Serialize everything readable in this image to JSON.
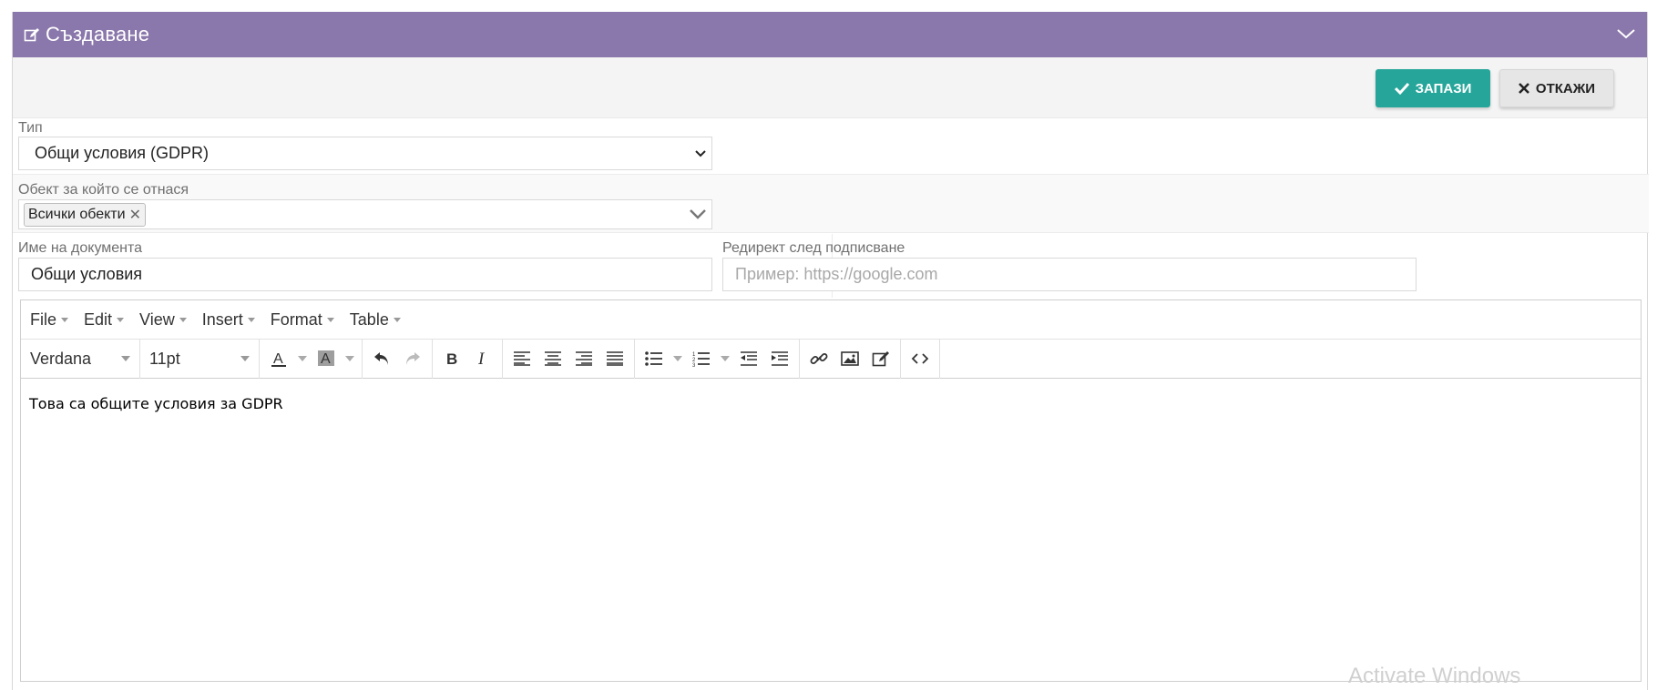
{
  "header": {
    "title": "Създаване"
  },
  "actions": {
    "save_label": "ЗАПАЗИ",
    "cancel_label": "ОТКАЖИ",
    "save_color": "#26a69a"
  },
  "form": {
    "type_label": "Тип",
    "type_value": "Общи условия (GDPR)",
    "object_label": "Обект за който се отнася",
    "object_tags": [
      "Всички обекти"
    ],
    "doc_name_label": "Име на документа",
    "doc_name_value": "Общи условия",
    "redirect_label": "Редирект след подписване",
    "redirect_placeholder": "Пример: https://google.com"
  },
  "editor": {
    "menus": [
      "File",
      "Edit",
      "View",
      "Insert",
      "Format",
      "Table"
    ],
    "font_family": "Verdana",
    "font_size": "11pt",
    "content": "Това са общите условия за GDPR",
    "toolbar_icons": [
      "text-color-icon",
      "background-color-icon",
      "undo-icon",
      "redo-icon",
      "bold-icon",
      "italic-icon",
      "align-left-icon",
      "align-center-icon",
      "align-right-icon",
      "align-justify-icon",
      "bullet-list-icon",
      "numbered-list-icon",
      "outdent-icon",
      "indent-icon",
      "link-icon",
      "image-icon",
      "edit-icon",
      "code-icon"
    ]
  },
  "system": {
    "watermark": "Activate Windows"
  },
  "colors": {
    "header_bg": "#8a77ab",
    "accent": "#26a69a"
  }
}
